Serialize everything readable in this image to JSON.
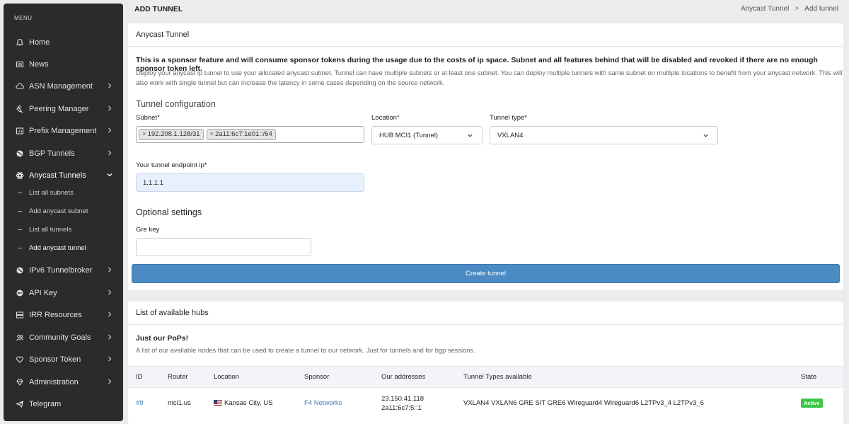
{
  "sidebar": {
    "menu_label": "MENU",
    "items": [
      {
        "label": "Home",
        "icon": "home-icon"
      },
      {
        "label": "News",
        "icon": "newspaper-icon"
      },
      {
        "label": "ASN Management",
        "icon": "cloud-icon"
      },
      {
        "label": "Peering Manager",
        "icon": "plug-icon"
      },
      {
        "label": "Prefix Management",
        "icon": "chart-icon"
      },
      {
        "label": "BGP Tunnels",
        "icon": "globe-icon"
      },
      {
        "label": "Anycast Tunnels",
        "icon": "atom-icon"
      },
      {
        "label": "IPv6 Tunnelbroker",
        "icon": "globe-icon"
      },
      {
        "label": "API Key",
        "icon": "key-icon"
      },
      {
        "label": "IRR Resources",
        "icon": "server-icon"
      },
      {
        "label": "Community Goals",
        "icon": "users-icon"
      },
      {
        "label": "Sponsor Token",
        "icon": "heart-icon"
      },
      {
        "label": "Administration",
        "icon": "gem-icon"
      },
      {
        "label": "Telegram",
        "icon": "send-icon"
      }
    ],
    "sub_items": [
      {
        "label": "List all subnets"
      },
      {
        "label": "Add anycast subnet"
      },
      {
        "label": "List all tunnels"
      },
      {
        "label": "Add anycast tunnel"
      }
    ]
  },
  "header": {
    "title": "ADD TUNNEL",
    "breadcrumb": [
      "Anycast Tunnel",
      "Add tunnel"
    ],
    "breadcrumb_sep": ">"
  },
  "form_card": {
    "title": "Anycast Tunnel",
    "warning": "This is a sponsor feature and will consume sponsor tokens during the usage due to the costs of ip space. Subnet and all features behind that will be disabled and revoked if there are no enough sponsor token left.",
    "description": "Deploy your anycast ip tunnel to use your allocated anycast subnet. Tunnel can have multiple subnets or at least one subnet. You can deploy multiple tunnels with same subnet on multiple locations to benefit from your anycast network. This will also work with single tunnel but can increase the latency in some cases depending on the source network.",
    "section_config": "Tunnel configuration",
    "subnet_label": "Subnet*",
    "subnet_tags": [
      "192.208.1.128/31",
      "2a11:6c7:1e01::/64"
    ],
    "tag_remove": "×",
    "location_label": "Location*",
    "location_value": "HUB MCI1 (Tunnel)",
    "tunnel_type_label": "Tunnel type*",
    "tunnel_type_value": "VXLAN4",
    "endpoint_label": "Your tunnel endpoint ip*",
    "endpoint_value": "1.1.1.1",
    "section_optional": "Optional settings",
    "gre_label": "Gre key",
    "gre_value": "",
    "submit_label": "Create tunnel"
  },
  "hubs_card": {
    "title": "List of available hubs",
    "subtitle": "Just our PoPs!",
    "description": "A list of our available nodes that can be used to create a tunnel to our network. Just for tunnels and for bgp sessions.",
    "columns": [
      "ID",
      "Router",
      "Location",
      "Sponsor",
      "Our addresses",
      "Tunnel Types available",
      "State"
    ],
    "rows": [
      {
        "id": "#9",
        "router": "mci1.us",
        "location": "Kansas City, US",
        "sponsor": "F4 Networks",
        "address_v4": "23.150.41.118",
        "address_v6": "2a11:6c7:5::1",
        "tunnel_types": "VXLAN4 VXLAN6 GRE SIT GRE6 Wireguard4 Wireguard6 L2TPv3_4 L2TPv3_6",
        "state": "Active"
      }
    ]
  },
  "colors": {
    "sidebar_bg": "#2b2b2b",
    "primary_button": "#4b8ac2",
    "active_badge": "#3ec64a",
    "link": "#3d7ab8"
  }
}
